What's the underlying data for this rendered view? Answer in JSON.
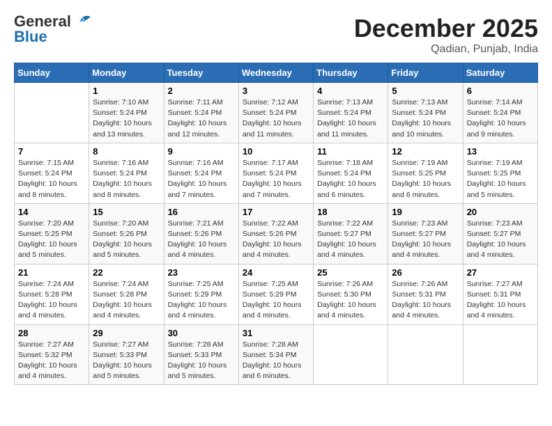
{
  "logo": {
    "line1": "General",
    "line2": "Blue"
  },
  "header": {
    "title": "December 2025",
    "location": "Qadian, Punjab, India"
  },
  "days_of_week": [
    "Sunday",
    "Monday",
    "Tuesday",
    "Wednesday",
    "Thursday",
    "Friday",
    "Saturday"
  ],
  "weeks": [
    [
      {
        "num": "",
        "info": ""
      },
      {
        "num": "1",
        "info": "Sunrise: 7:10 AM\nSunset: 5:24 PM\nDaylight: 10 hours\nand 13 minutes."
      },
      {
        "num": "2",
        "info": "Sunrise: 7:11 AM\nSunset: 5:24 PM\nDaylight: 10 hours\nand 12 minutes."
      },
      {
        "num": "3",
        "info": "Sunrise: 7:12 AM\nSunset: 5:24 PM\nDaylight: 10 hours\nand 11 minutes."
      },
      {
        "num": "4",
        "info": "Sunrise: 7:13 AM\nSunset: 5:24 PM\nDaylight: 10 hours\nand 11 minutes."
      },
      {
        "num": "5",
        "info": "Sunrise: 7:13 AM\nSunset: 5:24 PM\nDaylight: 10 hours\nand 10 minutes."
      },
      {
        "num": "6",
        "info": "Sunrise: 7:14 AM\nSunset: 5:24 PM\nDaylight: 10 hours\nand 9 minutes."
      }
    ],
    [
      {
        "num": "7",
        "info": "Sunrise: 7:15 AM\nSunset: 5:24 PM\nDaylight: 10 hours\nand 8 minutes."
      },
      {
        "num": "8",
        "info": "Sunrise: 7:16 AM\nSunset: 5:24 PM\nDaylight: 10 hours\nand 8 minutes."
      },
      {
        "num": "9",
        "info": "Sunrise: 7:16 AM\nSunset: 5:24 PM\nDaylight: 10 hours\nand 7 minutes."
      },
      {
        "num": "10",
        "info": "Sunrise: 7:17 AM\nSunset: 5:24 PM\nDaylight: 10 hours\nand 7 minutes."
      },
      {
        "num": "11",
        "info": "Sunrise: 7:18 AM\nSunset: 5:24 PM\nDaylight: 10 hours\nand 6 minutes."
      },
      {
        "num": "12",
        "info": "Sunrise: 7:19 AM\nSunset: 5:25 PM\nDaylight: 10 hours\nand 6 minutes."
      },
      {
        "num": "13",
        "info": "Sunrise: 7:19 AM\nSunset: 5:25 PM\nDaylight: 10 hours\nand 5 minutes."
      }
    ],
    [
      {
        "num": "14",
        "info": "Sunrise: 7:20 AM\nSunset: 5:25 PM\nDaylight: 10 hours\nand 5 minutes."
      },
      {
        "num": "15",
        "info": "Sunrise: 7:20 AM\nSunset: 5:26 PM\nDaylight: 10 hours\nand 5 minutes."
      },
      {
        "num": "16",
        "info": "Sunrise: 7:21 AM\nSunset: 5:26 PM\nDaylight: 10 hours\nand 4 minutes."
      },
      {
        "num": "17",
        "info": "Sunrise: 7:22 AM\nSunset: 5:26 PM\nDaylight: 10 hours\nand 4 minutes."
      },
      {
        "num": "18",
        "info": "Sunrise: 7:22 AM\nSunset: 5:27 PM\nDaylight: 10 hours\nand 4 minutes."
      },
      {
        "num": "19",
        "info": "Sunrise: 7:23 AM\nSunset: 5:27 PM\nDaylight: 10 hours\nand 4 minutes."
      },
      {
        "num": "20",
        "info": "Sunrise: 7:23 AM\nSunset: 5:27 PM\nDaylight: 10 hours\nand 4 minutes."
      }
    ],
    [
      {
        "num": "21",
        "info": "Sunrise: 7:24 AM\nSunset: 5:28 PM\nDaylight: 10 hours\nand 4 minutes."
      },
      {
        "num": "22",
        "info": "Sunrise: 7:24 AM\nSunset: 5:28 PM\nDaylight: 10 hours\nand 4 minutes."
      },
      {
        "num": "23",
        "info": "Sunrise: 7:25 AM\nSunset: 5:29 PM\nDaylight: 10 hours\nand 4 minutes."
      },
      {
        "num": "24",
        "info": "Sunrise: 7:25 AM\nSunset: 5:29 PM\nDaylight: 10 hours\nand 4 minutes."
      },
      {
        "num": "25",
        "info": "Sunrise: 7:26 AM\nSunset: 5:30 PM\nDaylight: 10 hours\nand 4 minutes."
      },
      {
        "num": "26",
        "info": "Sunrise: 7:26 AM\nSunset: 5:31 PM\nDaylight: 10 hours\nand 4 minutes."
      },
      {
        "num": "27",
        "info": "Sunrise: 7:27 AM\nSunset: 5:31 PM\nDaylight: 10 hours\nand 4 minutes."
      }
    ],
    [
      {
        "num": "28",
        "info": "Sunrise: 7:27 AM\nSunset: 5:32 PM\nDaylight: 10 hours\nand 4 minutes."
      },
      {
        "num": "29",
        "info": "Sunrise: 7:27 AM\nSunset: 5:33 PM\nDaylight: 10 hours\nand 5 minutes."
      },
      {
        "num": "30",
        "info": "Sunrise: 7:28 AM\nSunset: 5:33 PM\nDaylight: 10 hours\nand 5 minutes."
      },
      {
        "num": "31",
        "info": "Sunrise: 7:28 AM\nSunset: 5:34 PM\nDaylight: 10 hours\nand 6 minutes."
      },
      {
        "num": "",
        "info": ""
      },
      {
        "num": "",
        "info": ""
      },
      {
        "num": "",
        "info": ""
      }
    ]
  ]
}
